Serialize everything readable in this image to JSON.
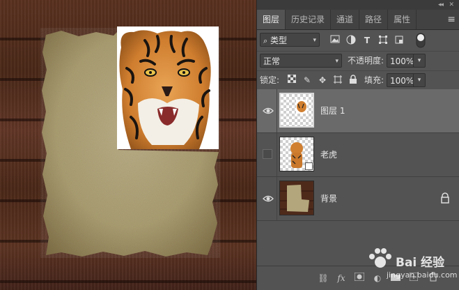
{
  "panel": {
    "tabs": [
      {
        "label": "图层"
      },
      {
        "label": "历史记录"
      },
      {
        "label": "通道"
      },
      {
        "label": "路径"
      },
      {
        "label": "属性"
      }
    ],
    "filter": {
      "value": "类型"
    },
    "blend_mode": {
      "value": "正常"
    },
    "opacity": {
      "label": "不透明度:",
      "value": "100%"
    },
    "lock": {
      "label": "锁定:"
    },
    "fill": {
      "label": "填充:",
      "value": "100%"
    },
    "layers": [
      {
        "name": "图层 1",
        "visible": true,
        "selected": true
      },
      {
        "name": "老虎",
        "visible": false,
        "selected": false
      },
      {
        "name": "背景",
        "visible": true,
        "selected": false,
        "locked": true
      }
    ],
    "bottom": {
      "fx": "fx"
    }
  },
  "watermark": {
    "text": "Bai 经验",
    "url": "jingyan.baidu.com"
  }
}
